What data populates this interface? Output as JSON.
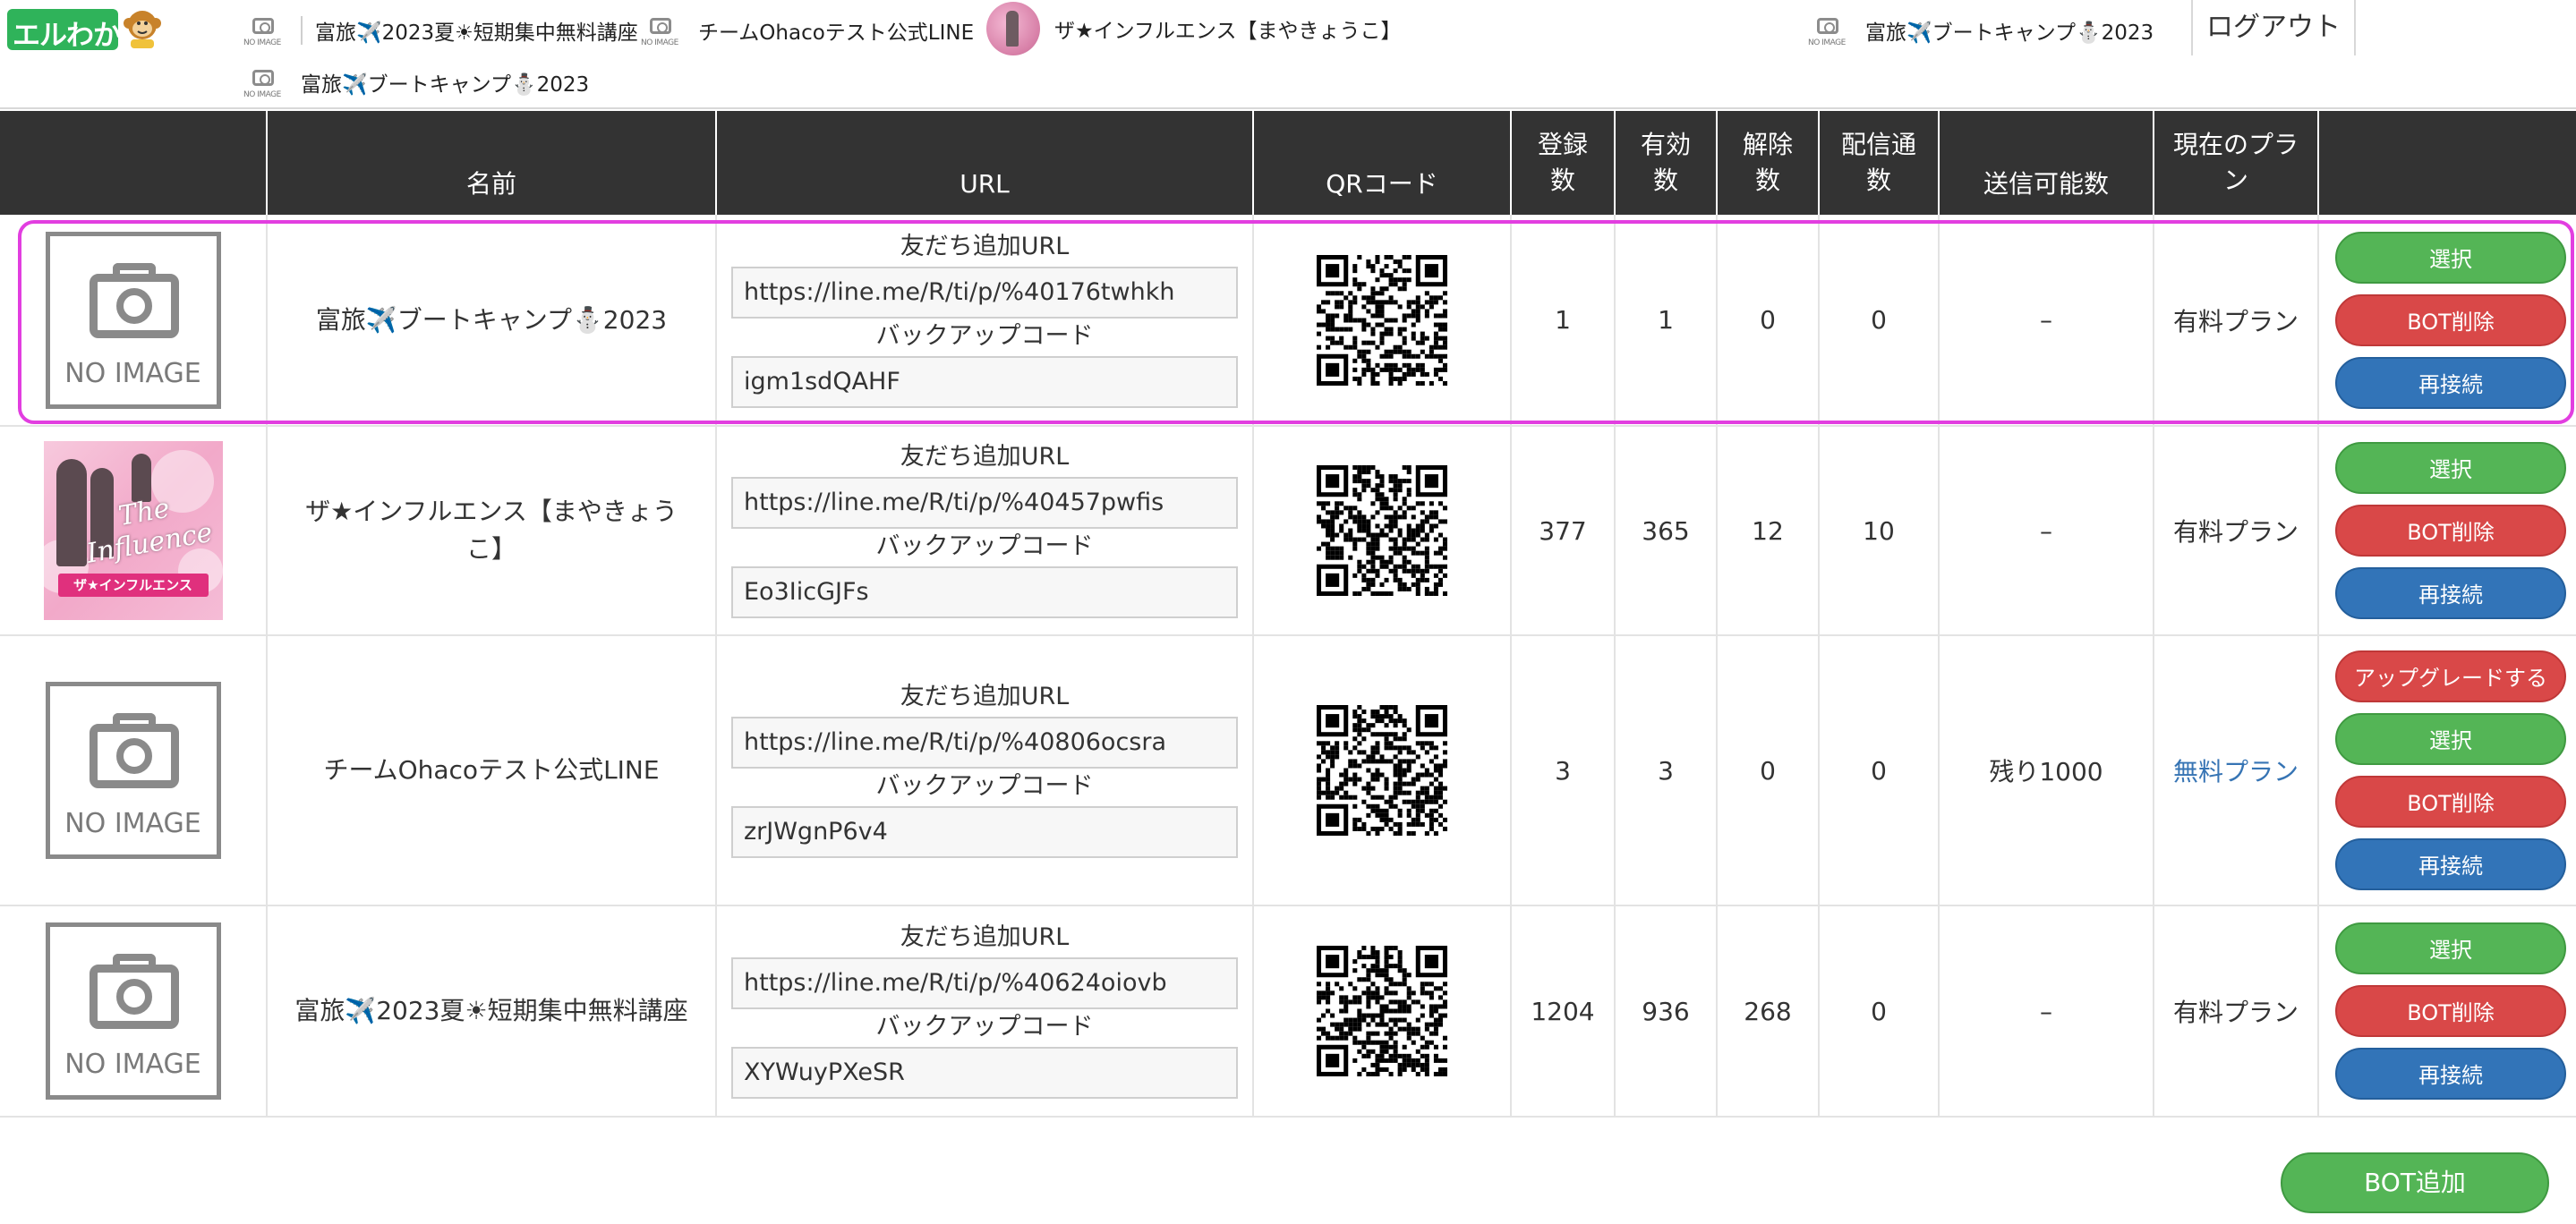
{
  "header": {
    "logo_text": "エルわか",
    "accounts": [
      {
        "name": "富旅✈️2023夏☀短期集中無料講座",
        "thumb": "no-image",
        "no_image_text": "NO IMAGE"
      },
      {
        "name": "チームOhacoテスト公式LINE",
        "thumb": "no-image",
        "no_image_text": "NO IMAGE"
      },
      {
        "name": "ザ★インフルエンス【まやきょうこ】",
        "thumb": "photo"
      },
      {
        "name": "富旅✈️ブートキャンプ⛄2023",
        "thumb": "no-image",
        "no_image_text": "NO IMAGE"
      },
      {
        "name": "富旅✈️ブートキャンプ⛄2023",
        "thumb": "no-image",
        "no_image_text": "NO IMAGE"
      }
    ],
    "logout_label": "ログアウト"
  },
  "table": {
    "headers": {
      "name": "名前",
      "url": "URL",
      "qr": "QRコード",
      "registered": "登録\n数",
      "valid": "有効\n数",
      "cancelled": "解除\n数",
      "delivered": "配信通\n数",
      "sendable": "送信可能数",
      "plan": "現在のプラ\nン"
    },
    "labels": {
      "friend_url": "友だち追加URL",
      "backup_code": "バックアップコード",
      "no_image": "NO IMAGE"
    },
    "rows": [
      {
        "thumb": "no-image",
        "name": "富旅✈️ブートキャンプ⛄2023",
        "friend_url": "https://line.me/R/ti/p/%40176twhkh",
        "backup_code": "igm1sdQAHF",
        "registered": "1",
        "valid": "1",
        "cancelled": "0",
        "delivered": "0",
        "sendable": "–",
        "plan": "有料プラン",
        "buttons": {
          "select": "選択",
          "delete": "BOT削除",
          "reconnect": "再接続"
        }
      },
      {
        "thumb": "photo",
        "photo_title": "The Influence",
        "photo_banner": "ザ★インフルエンス",
        "name": "ザ★インフルエンス【まやきょうこ】",
        "friend_url": "https://line.me/R/ti/p/%40457pwfis",
        "backup_code": "Eo3IicGJFs",
        "registered": "377",
        "valid": "365",
        "cancelled": "12",
        "delivered": "10",
        "sendable": "–",
        "plan": "有料プラン",
        "buttons": {
          "select": "選択",
          "delete": "BOT削除",
          "reconnect": "再接続"
        }
      },
      {
        "thumb": "no-image",
        "name": "チームOhacoテスト公式LINE",
        "friend_url": "https://line.me/R/ti/p/%40806ocsra",
        "backup_code": "zrJWgnP6v4",
        "registered": "3",
        "valid": "3",
        "cancelled": "0",
        "delivered": "0",
        "sendable": "残り1000",
        "plan": "無料プラン",
        "buttons": {
          "upgrade": "アップグレードする",
          "select": "選択",
          "delete": "BOT削除",
          "reconnect": "再接続"
        }
      },
      {
        "thumb": "no-image",
        "name": "富旅✈️2023夏☀短期集中無料講座",
        "friend_url": "https://line.me/R/ti/p/%40624oiovb",
        "backup_code": "XYWuyPXeSR",
        "registered": "1204",
        "valid": "936",
        "cancelled": "268",
        "delivered": "0",
        "sendable": "–",
        "plan": "有料プラン",
        "buttons": {
          "select": "選択",
          "delete": "BOT削除",
          "reconnect": "再接続"
        }
      }
    ]
  },
  "footer": {
    "add_bot_label": "BOT追加"
  },
  "colors": {
    "header_bg": "#333333",
    "green": "#54b556",
    "red": "#d94848",
    "blue": "#3274b8",
    "highlight": "#e23ee0",
    "link": "#3674b4"
  }
}
